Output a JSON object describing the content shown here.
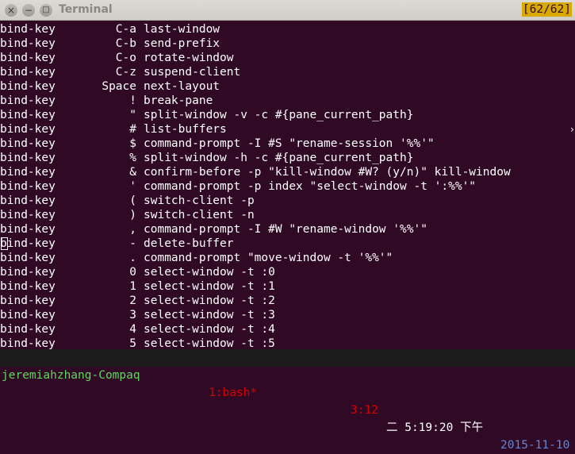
{
  "window": {
    "title": "Terminal",
    "close_glyph": "×",
    "min_glyph": "−",
    "max_glyph": "□"
  },
  "tmux": {
    "position_indicator": "[62/62]",
    "lines": [
      {
        "cmd": "bind-key",
        "key": "C-a",
        "action": "last-window"
      },
      {
        "cmd": "bind-key",
        "key": "C-b",
        "action": "send-prefix"
      },
      {
        "cmd": "bind-key",
        "key": "C-o",
        "action": "rotate-window"
      },
      {
        "cmd": "bind-key",
        "key": "C-z",
        "action": "suspend-client"
      },
      {
        "cmd": "bind-key",
        "key": "Space",
        "action": "next-layout"
      },
      {
        "cmd": "bind-key",
        "key": "!",
        "action": "break-pane"
      },
      {
        "cmd": "bind-key",
        "key": "\"",
        "action": "split-window -v -c #{pane_current_path}"
      },
      {
        "cmd": "bind-key",
        "key": "#",
        "action": "list-buffers"
      },
      {
        "cmd": "bind-key",
        "key": "$",
        "action": "command-prompt -I #S \"rename-session '%%'\""
      },
      {
        "cmd": "bind-key",
        "key": "%",
        "action": "split-window -h -c #{pane_current_path}"
      },
      {
        "cmd": "bind-key",
        "key": "&",
        "action": "confirm-before -p \"kill-window #W? (y/n)\" kill-window"
      },
      {
        "cmd": "bind-key",
        "key": "'",
        "action": "command-prompt -p index \"select-window -t ':%%'\""
      },
      {
        "cmd": "bind-key",
        "key": "(",
        "action": "switch-client -p"
      },
      {
        "cmd": "bind-key",
        "key": ")",
        "action": "switch-client -n"
      },
      {
        "cmd": "bind-key",
        "key": ",",
        "action": "command-prompt -I #W \"rename-window '%%'\""
      },
      {
        "cmd": "bind-key",
        "key": "-",
        "action": "delete-buffer"
      },
      {
        "cmd": "bind-key",
        "key": ".",
        "action": "command-prompt \"move-window -t '%%'\""
      },
      {
        "cmd": "bind-key",
        "key": "0",
        "action": "select-window -t :0"
      },
      {
        "cmd": "bind-key",
        "key": "1",
        "action": "select-window -t :1"
      },
      {
        "cmd": "bind-key",
        "key": "2",
        "action": "select-window -t :2"
      },
      {
        "cmd": "bind-key",
        "key": "3",
        "action": "select-window -t :3"
      },
      {
        "cmd": "bind-key",
        "key": "4",
        "action": "select-window -t :4"
      },
      {
        "cmd": "bind-key",
        "key": "5",
        "action": "select-window -t :5"
      }
    ],
    "cursor_line": 15
  },
  "status_bar": {
    "session_host": "jeremiahzhang-Compaq",
    "window_list": "1:bash*",
    "pane_info": "3:12",
    "time": "二 5:19:20 下午",
    "date": "2015-11-10"
  },
  "colors": {
    "background": "#300a24",
    "text": "#ffffff",
    "position_badge": "#d9a900",
    "status_host": "#5fd75f",
    "status_window": "#d70000",
    "status_date": "#5f87d7"
  }
}
